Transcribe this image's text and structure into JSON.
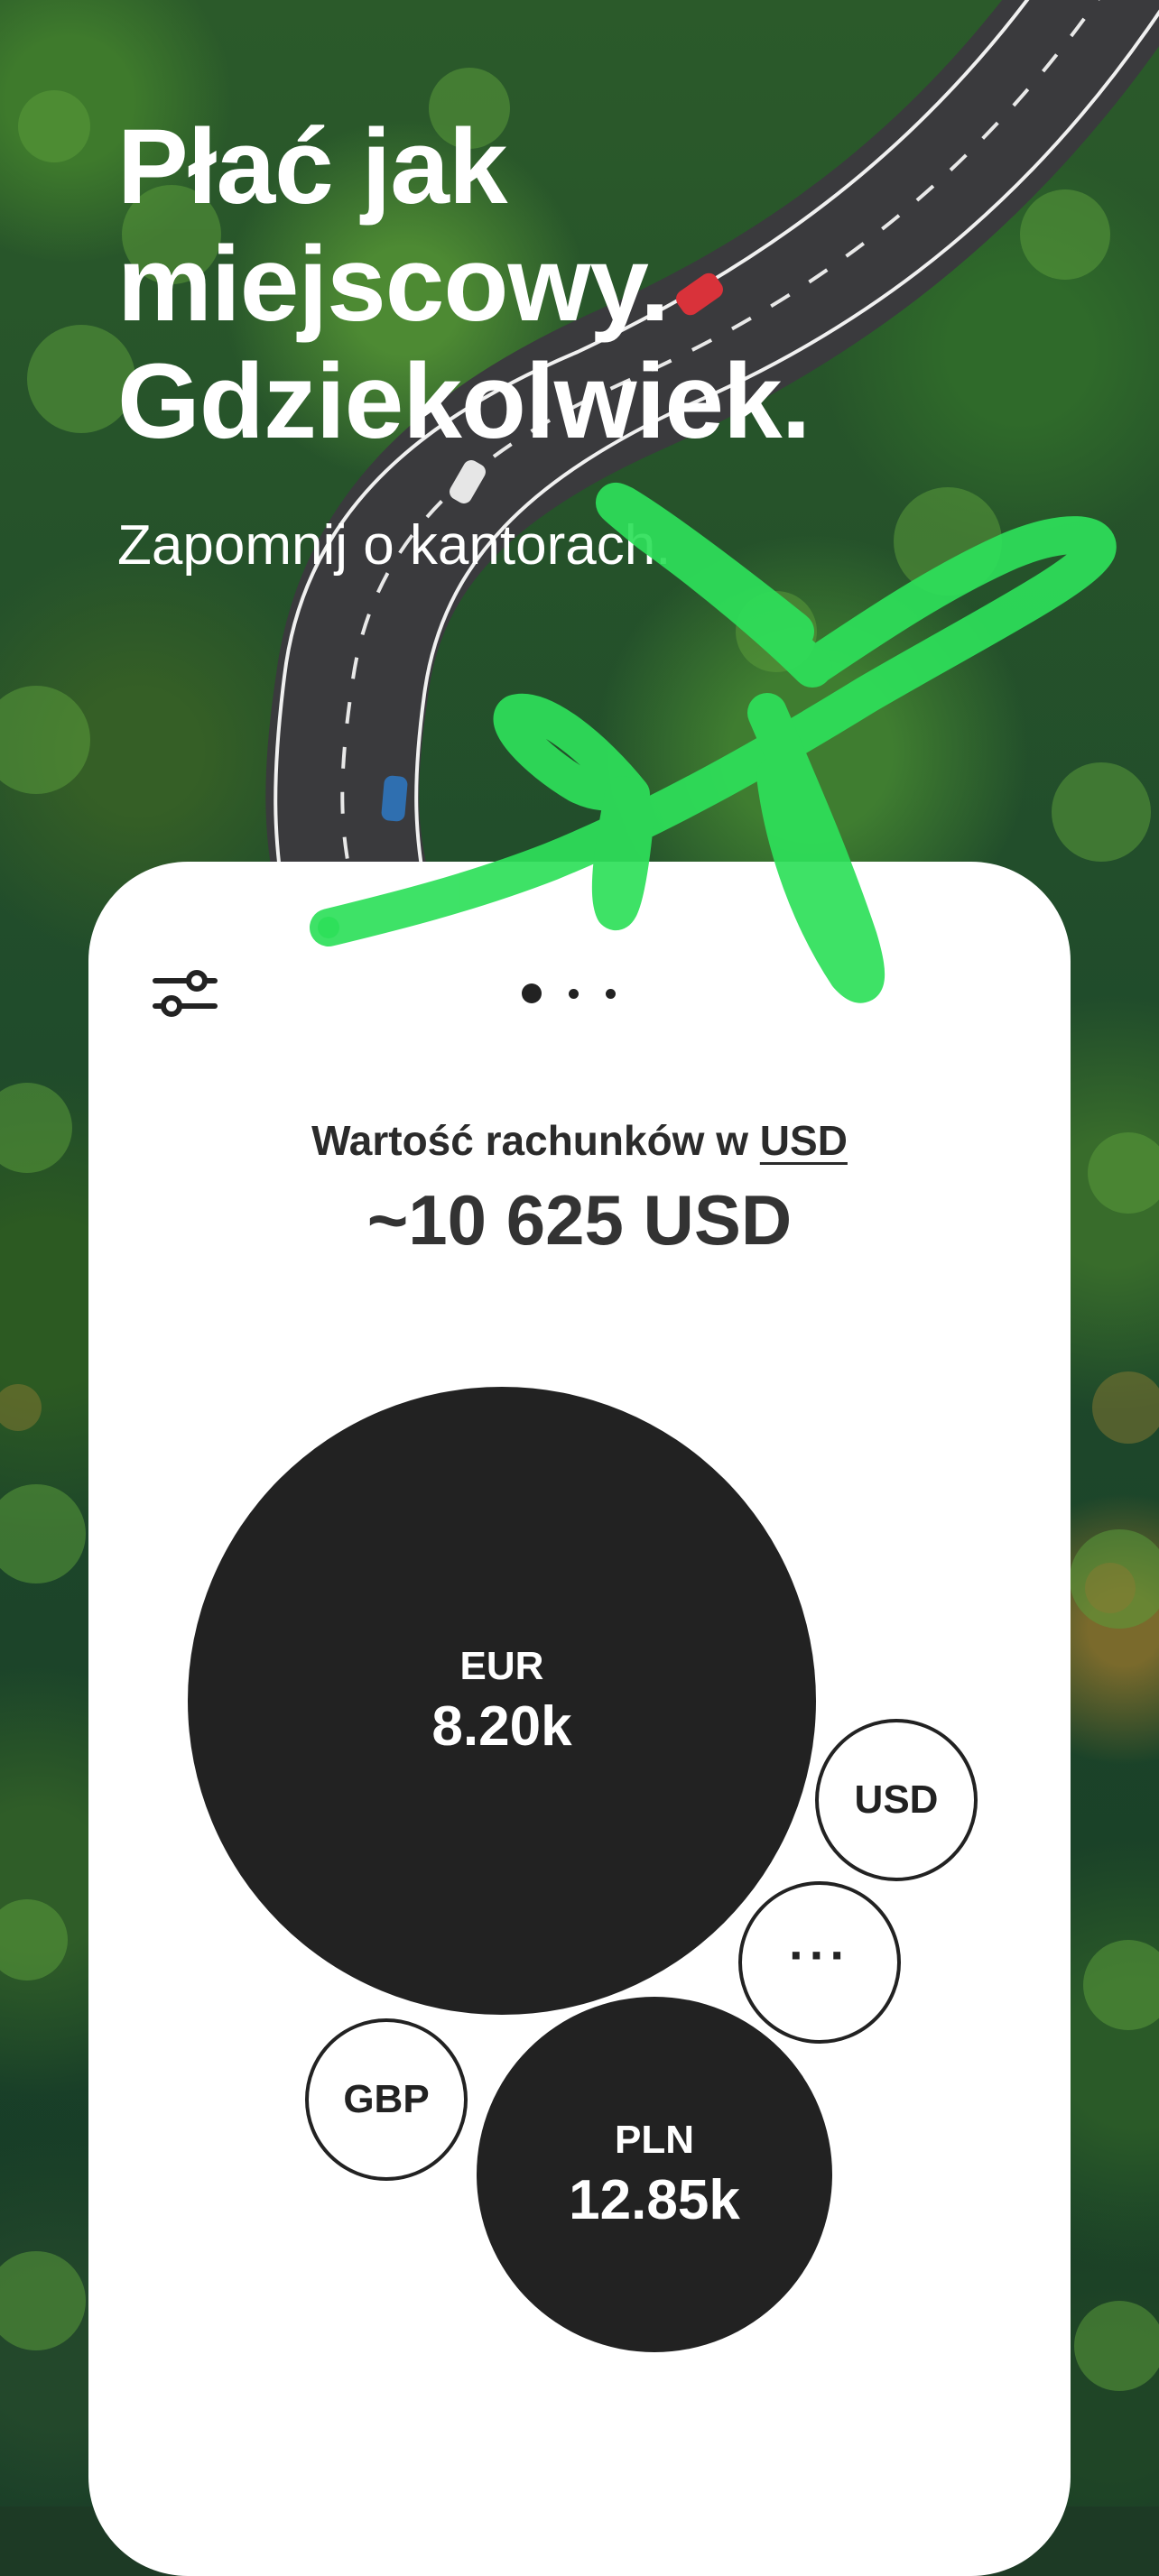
{
  "hero": {
    "title": "Płać jak\nmiejscowy.\nGdziekolwiek.",
    "subtitle": "Zapomnij o kantorach."
  },
  "card": {
    "filter_icon": "sliders-icon",
    "page_indicator": {
      "count": 3,
      "active_index": 0
    },
    "value_label_prefix": "Wartość rachunków w",
    "value_label_currency": "USD",
    "total_value": "~10 625 USD"
  },
  "bubbles": [
    {
      "code": "EUR",
      "amount": "8.20k",
      "style": "filled"
    },
    {
      "code": "USD",
      "style": "outline"
    },
    {
      "code": "···",
      "style": "outline",
      "icon": "more-icon"
    },
    {
      "code": "GBP",
      "style": "outline"
    },
    {
      "code": "PLN",
      "amount": "12.85k",
      "style": "filled"
    }
  ],
  "colors": {
    "accent_green": "#2ee05a",
    "bubble_dark": "#222222",
    "card_bg": "#ffffff",
    "hero_text": "#ffffff"
  }
}
